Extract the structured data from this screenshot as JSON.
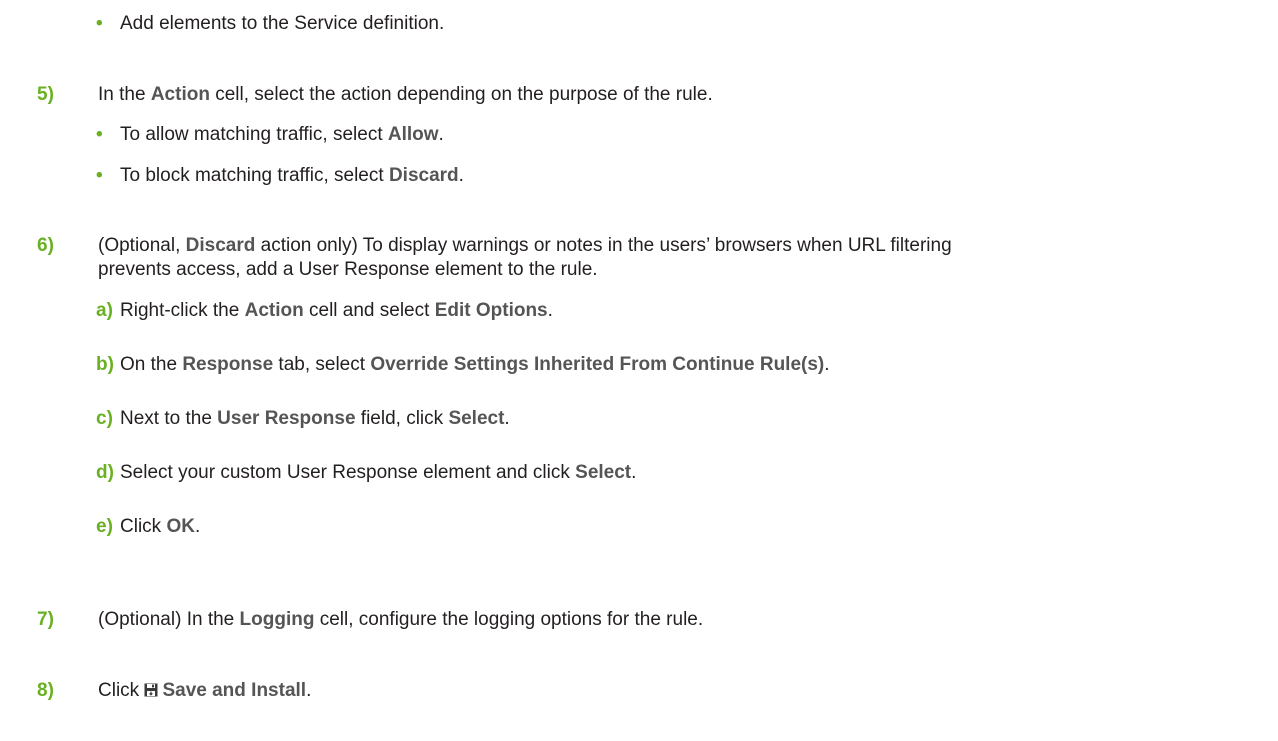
{
  "colors": {
    "step_number": "#6ab023",
    "bullet": "#6ab023",
    "ui_term": "#555555",
    "body_text": "#231f20"
  },
  "bullet_char": "•",
  "prev_bullet": {
    "text": "Add elements to the Service definition."
  },
  "step5": {
    "num": "5)",
    "t1": "In the ",
    "b1": "Action",
    "t2": " cell, select the action depending on the purpose of the rule.",
    "bullets": [
      {
        "t1": "To allow matching traffic, select ",
        "b1": "Allow",
        "t2": "."
      },
      {
        "t1": "To block matching traffic, select ",
        "b1": "Discard",
        "t2": "."
      }
    ]
  },
  "step6": {
    "num": "6)",
    "t1": "(Optional, ",
    "b1": "Discard",
    "t2": " action only) To display warnings or notes in the users’ browsers when URL filtering",
    "line2": "prevents access, add a User Response element to the rule.",
    "substeps": [
      {
        "label": "a)",
        "t1": "Right-click the ",
        "b1": "Action",
        "t2": " cell and select ",
        "b2": "Edit Options",
        "t3": "."
      },
      {
        "label": "b)",
        "t1": "On the ",
        "b1": "Response",
        "t2": " tab, select ",
        "b2": "Override Settings Inherited From Continue Rule(s)",
        "t3": "."
      },
      {
        "label": "c)",
        "t1": "Next to the ",
        "b1": "User Response",
        "t2": " field, click ",
        "b2": "Select",
        "t3": "."
      },
      {
        "label": "d)",
        "t1": "Select your custom User Response element and click ",
        "b1": "Select",
        "t2": "."
      },
      {
        "label": "e)",
        "t1": "Click ",
        "b1": "OK",
        "t2": "."
      }
    ]
  },
  "step7": {
    "num": "7)",
    "t1": "(Optional) In the ",
    "b1": "Logging",
    "t2": " cell, configure the logging options for the rule."
  },
  "step8": {
    "num": "8)",
    "t1": "Click ",
    "icon": "save-and-install-icon",
    "b1": "Save and Install",
    "t2": "."
  }
}
